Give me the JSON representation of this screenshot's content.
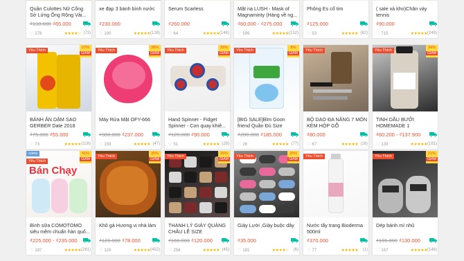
{
  "colors": {
    "accent": "#ee4d2d",
    "badge": "#ffd839",
    "star": "#f8b400",
    "shipping": "#00bfa5"
  },
  "badge_fav": "Yêu Thích",
  "badge_giam": "GIẢM",
  "rows": [
    {
      "cards": [
        {
          "name": "Quần Culottes Nữ Cổng Sở Lửng Ống Rộng Vải...",
          "old": "₫130.000",
          "price": "₫65.000",
          "likes": "278",
          "stars": "★★★★☆",
          "count": "(73)"
        },
        {
          "name": "xe đạp 3 bánh bình nước",
          "old": "",
          "price": "₫230.000",
          "likes": "190",
          "stars": "★★★★★",
          "count": "(128)"
        },
        {
          "name": "Serum Scarless",
          "old": "",
          "price": "₫260.000",
          "likes": "64",
          "stars": "★★★★★",
          "count": "(148)"
        },
        {
          "name": "Mặt nạ LUSH - Mask of Magnaminty (Hàng về ng...",
          "old": "",
          "price": "₫60.000 - ₫275.000",
          "likes": "599",
          "stars": "★★★★★",
          "count": "(132)"
        },
        {
          "name": "Phông Es cổ tim",
          "old": "",
          "price": "₫125.000",
          "likes": "53",
          "stars": "★★★★★",
          "count": "(62)"
        },
        {
          "name": "( sale xả kho)Chân váy tennis",
          "old": "",
          "price": "₫90.000",
          "likes": "715",
          "stars": "★★★★★",
          "count": "(249)"
        }
      ]
    },
    {
      "cards": [
        {
          "name": "BÁNH ĂN DẶM SAO GERBER Date 2018",
          "old": "₫75.000",
          "price": "₫55.000",
          "likes": "73",
          "stars": "★★★★★",
          "count": "(116)",
          "disc": "27%"
        },
        {
          "name": "Máy Rửa Mặt OFY-666",
          "old": "₫380.000",
          "price": "₫237.000",
          "likes": "159",
          "stars": "★★★★★",
          "count": "(47)",
          "disc": "38%"
        },
        {
          "name": "Hand Spinner - Fidget Spinner - Con quay khiê...",
          "old": "₫120.000",
          "price": "₫90.000",
          "likes": "51",
          "stars": "★★★★★",
          "count": "(28)",
          "disc": "25%"
        },
        {
          "name": "[BIG SALE]Bỉm Goon friend Quần Đủ Size",
          "old": "₫200.000",
          "price": "₫185.000",
          "likes": "26",
          "stars": "★★★★★",
          "count": "(77)",
          "disc": "8%"
        },
        {
          "name": "BỘ DAO ĐA NĂNG 7 MÓN KÈM HỘP GỖ",
          "old": "",
          "price": "₫80.000",
          "likes": "67",
          "stars": "★★★★★",
          "count": "(16)"
        },
        {
          "name": "TINH DẦU BƯỞI HOMEMADE 1",
          "old": "",
          "price": "₫60.200 - ₫137.900",
          "likes": "139",
          "stars": "★★★★★",
          "count": "(181)",
          "disc": "34%"
        }
      ]
    },
    {
      "cards": [
        {
          "name": "Bình sữa COMOTOMO siêu mềm chuẩn hàn quố...",
          "old": "",
          "price": "₫225.000 - ₫235.000",
          "likes": "187",
          "stars": "★★★★★",
          "count": "(281)",
          "disc": "41%",
          "como": "como",
          "overlay": "Bán Chạy"
        },
        {
          "name": "Khô gà Hương vị nhà làm",
          "old": "₫120.000",
          "price": "₫78.000",
          "likes": "119",
          "stars": "★★★★★",
          "count": "(452)",
          "disc": "35%"
        },
        {
          "name": "THANH LÝ GIÀY QUẢNG CHÂU LỄ SIZE",
          "old": "₫160.000",
          "price": "₫120.000",
          "likes": "258",
          "stars": "★★★★★",
          "count": "(45)",
          "disc": "25%"
        },
        {
          "name": "Giày Lười ,Giày buộc dây",
          "old": "",
          "price": "₫35.000",
          "likes": "181",
          "stars": "★★★★☆",
          "count": "(6)",
          "disc": "20%"
        },
        {
          "name": "Nước tẩy trang Bioderma 500ml",
          "old": "",
          "price": "₫370.000",
          "likes": "77",
          "stars": "★★★★★",
          "count": "(1)"
        },
        {
          "name": "Dép bánh mì nhũ",
          "old": "₫165.000",
          "price": "₫130.000",
          "likes": "167",
          "stars": "★★★★★",
          "count": "(146)",
          "disc": "21%"
        }
      ]
    }
  ]
}
